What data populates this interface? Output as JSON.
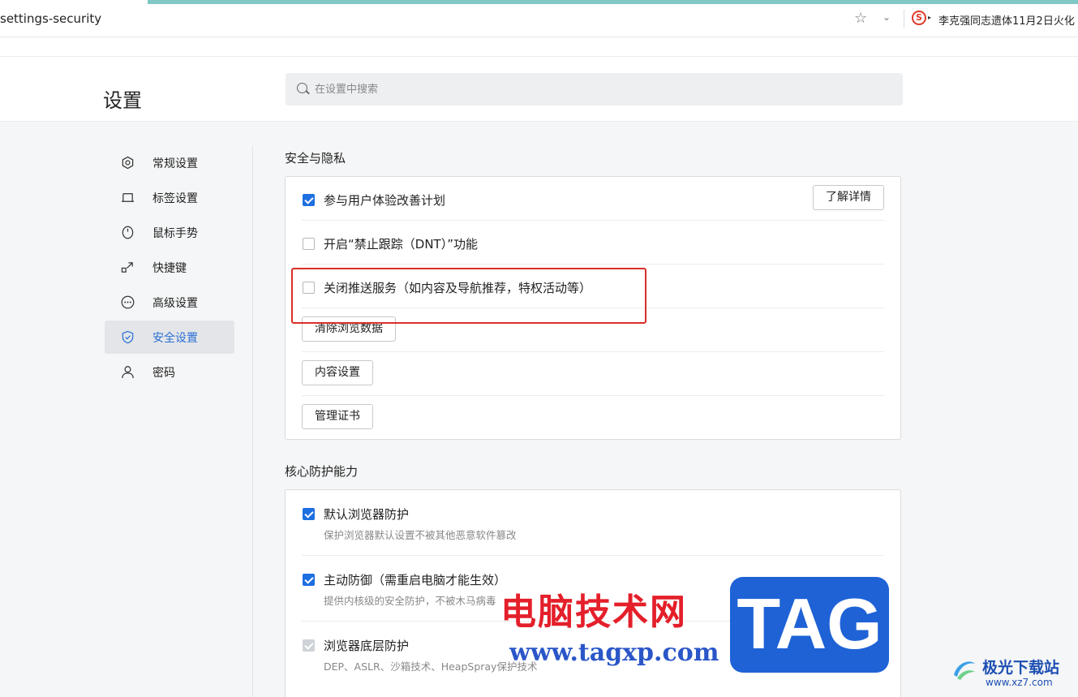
{
  "browser": {
    "url": "settings-security",
    "news_ticker": "李克强同志遗体11月2日火化"
  },
  "header": {
    "title": "设置",
    "search_placeholder": "在设置中搜索"
  },
  "sidebar": {
    "items": [
      {
        "label": "常规设置",
        "icon": "gear-icon"
      },
      {
        "label": "标签设置",
        "icon": "tab-icon"
      },
      {
        "label": "鼠标手势",
        "icon": "mouse-icon"
      },
      {
        "label": "快捷键",
        "icon": "shortcut-icon"
      },
      {
        "label": "高级设置",
        "icon": "more-icon"
      },
      {
        "label": "安全设置",
        "icon": "shield-icon",
        "active": true
      },
      {
        "label": "密码",
        "icon": "user-icon"
      }
    ]
  },
  "privacy": {
    "title": "安全与隐私",
    "ux_plan": {
      "label": "参与用户体验改善计划",
      "checked": true
    },
    "learn_more": "了解详情",
    "dnt": {
      "label": "开启“禁止跟踪（DNT）”功能",
      "checked": false
    },
    "push": {
      "label": "关闭推送服务（如内容及导航推荐，特权活动等）",
      "checked": false
    },
    "clear_data": "清除浏览数据",
    "content_settings": "内容设置",
    "manage_certs": "管理证书"
  },
  "core": {
    "title": "核心防护能力",
    "items": [
      {
        "label": "默认浏览器防护",
        "desc": "保护浏览器默认设置不被其他恶意软件篡改",
        "checked": true
      },
      {
        "label": "主动防御（需重启电脑才能生效）",
        "desc": "提供内核级的安全防护，不被木马病毒",
        "checked": true
      },
      {
        "label": "浏览器底层防护",
        "desc": "DEP、ASLR、沙箱技术、HeapSpray保护技术",
        "checked": true,
        "disabled": true
      }
    ]
  },
  "watermark": {
    "cn_text": "电脑技术网",
    "url": "www.tagxp.com",
    "tag": "TAG",
    "site_name": "极光下载站",
    "site_url": "www.xz7.com"
  },
  "colors": {
    "accent": "#1e6fe0",
    "highlight": "#d9302a"
  }
}
